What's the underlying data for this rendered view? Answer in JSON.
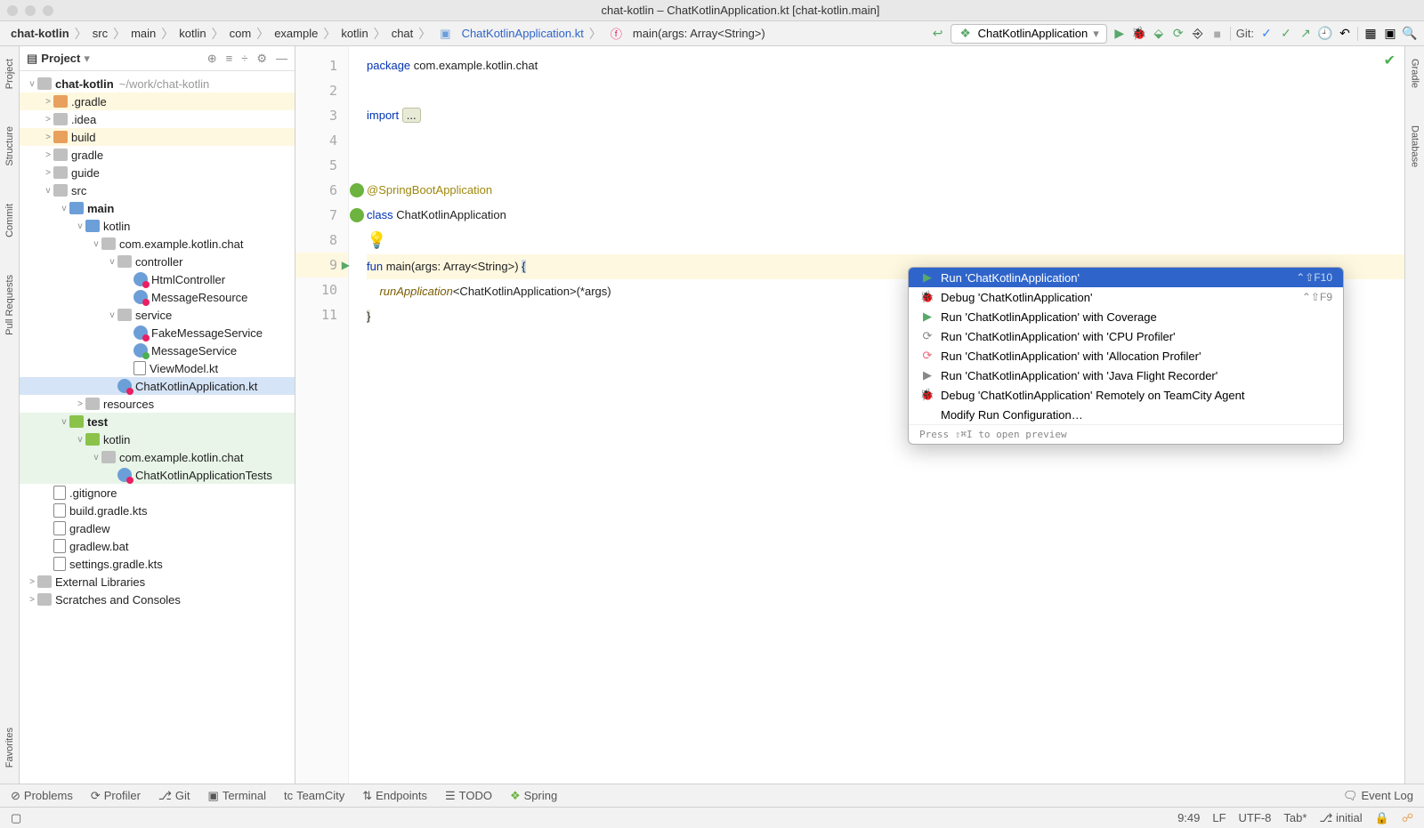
{
  "window": {
    "title": "chat-kotlin – ChatKotlinApplication.kt [chat-kotlin.main]"
  },
  "breadcrumb": {
    "parts": [
      "chat-kotlin",
      "src",
      "main",
      "kotlin",
      "com",
      "example",
      "kotlin",
      "chat"
    ],
    "file": "ChatKotlinApplication.kt",
    "method": "main(args: Array<String>)"
  },
  "runConfig": {
    "name": "ChatKotlinApplication"
  },
  "gitLabel": "Git:",
  "leftStrip": {
    "project": "Project",
    "structure": "Structure",
    "commit": "Commit",
    "pullRequests": "Pull Requests",
    "favorites": "Favorites"
  },
  "rightStrip": {
    "gradle": "Gradle",
    "database": "Database"
  },
  "projectHeader": {
    "title": "Project"
  },
  "tree": {
    "root": {
      "name": "chat-kotlin",
      "path": "~/work/chat-kotlin"
    },
    "items": [
      {
        "indent": 1,
        "tw": ">",
        "icon": "folder-orange",
        "label": ".gradle",
        "cls": "build"
      },
      {
        "indent": 1,
        "tw": ">",
        "icon": "folder-gray",
        "label": ".idea"
      },
      {
        "indent": 1,
        "tw": ">",
        "icon": "folder-orange",
        "label": "build",
        "cls": "build"
      },
      {
        "indent": 1,
        "tw": ">",
        "icon": "folder-gray",
        "label": "gradle"
      },
      {
        "indent": 1,
        "tw": ">",
        "icon": "folder-gray",
        "label": "guide"
      },
      {
        "indent": 1,
        "tw": "v",
        "icon": "folder-gray",
        "label": "src"
      },
      {
        "indent": 2,
        "tw": "v",
        "icon": "folder-blue",
        "label": "main",
        "bold": true
      },
      {
        "indent": 3,
        "tw": "v",
        "icon": "folder-blue",
        "label": "kotlin"
      },
      {
        "indent": 4,
        "tw": "v",
        "icon": "folder-gray",
        "label": "com.example.kotlin.chat"
      },
      {
        "indent": 5,
        "tw": "v",
        "icon": "folder-gray",
        "label": "controller"
      },
      {
        "indent": 6,
        "tw": "",
        "icon": "kt-pink",
        "label": "HtmlController"
      },
      {
        "indent": 6,
        "tw": "",
        "icon": "kt-pink",
        "label": "MessageResource"
      },
      {
        "indent": 5,
        "tw": "v",
        "icon": "folder-gray",
        "label": "service"
      },
      {
        "indent": 6,
        "tw": "",
        "icon": "kt-pink",
        "label": "FakeMessageService"
      },
      {
        "indent": 6,
        "tw": "",
        "icon": "kt-green",
        "label": "MessageService"
      },
      {
        "indent": 6,
        "tw": "",
        "icon": "file",
        "label": "ViewModel.kt"
      },
      {
        "indent": 5,
        "tw": "",
        "icon": "kt-pink",
        "label": "ChatKotlinApplication.kt",
        "selected": true
      },
      {
        "indent": 3,
        "tw": ">",
        "icon": "folder-gray",
        "label": "resources"
      },
      {
        "indent": 2,
        "tw": "v",
        "icon": "folder-green",
        "label": "test",
        "bold": true,
        "cls": "testgreen"
      },
      {
        "indent": 3,
        "tw": "v",
        "icon": "folder-green",
        "label": "kotlin",
        "cls": "testgreen"
      },
      {
        "indent": 4,
        "tw": "v",
        "icon": "folder-gray",
        "label": "com.example.kotlin.chat",
        "cls": "testgreen"
      },
      {
        "indent": 5,
        "tw": "",
        "icon": "kt-pink",
        "label": "ChatKotlinApplicationTests",
        "cls": "testgreen"
      },
      {
        "indent": 1,
        "tw": "",
        "icon": "file",
        "label": ".gitignore"
      },
      {
        "indent": 1,
        "tw": "",
        "icon": "file",
        "label": "build.gradle.kts"
      },
      {
        "indent": 1,
        "tw": "",
        "icon": "file",
        "label": "gradlew"
      },
      {
        "indent": 1,
        "tw": "",
        "icon": "file",
        "label": "gradlew.bat"
      },
      {
        "indent": 1,
        "tw": "",
        "icon": "file",
        "label": "settings.gradle.kts"
      }
    ],
    "extLib": "External Libraries",
    "scratches": "Scratches and Consoles"
  },
  "code": {
    "lines": [
      "1",
      "2",
      "3",
      "4",
      "5",
      "6",
      "7",
      "8",
      "9",
      "10",
      "11"
    ],
    "l1_kw": "package",
    "l1_pkg": " com.example.kotlin.chat",
    "l3_kw": "import ",
    "l3_fold": "...",
    "l6_ann": "@SpringBootApplication",
    "l7_kw": "class ",
    "l7_cls": "ChatKotlinApplication",
    "l9_kw": "fun ",
    "l9_fn": "main",
    "l9_sig": "(args: Array<String>) ",
    "l9_brace": "{",
    "l10_it": "runApplication",
    "l10_rest": "<ChatKotlinApplication>(*args)",
    "l11": "}"
  },
  "menu": {
    "items": [
      {
        "icon": "▶",
        "iconColor": "#59a869",
        "label": "Run 'ChatKotlinApplication'",
        "shortcut": "⌃⇧F10",
        "selected": true
      },
      {
        "icon": "🐞",
        "iconColor": "#59a869",
        "label": "Debug 'ChatKotlinApplication'",
        "shortcut": "⌃⇧F9"
      },
      {
        "icon": "▶",
        "iconColor": "#59a869",
        "label": "Run 'ChatKotlinApplication' with Coverage"
      },
      {
        "icon": "⟳",
        "iconColor": "#888",
        "label": "Run 'ChatKotlinApplication' with 'CPU Profiler'"
      },
      {
        "icon": "⟳",
        "iconColor": "#e67",
        "label": "Run 'ChatKotlinApplication' with 'Allocation Profiler'"
      },
      {
        "icon": "▶",
        "iconColor": "#888",
        "label": "Run 'ChatKotlinApplication' with 'Java Flight Recorder'"
      },
      {
        "icon": "🐞",
        "iconColor": "#59a869",
        "label": "Debug 'ChatKotlinApplication' Remotely on TeamCity Agent"
      },
      {
        "icon": "",
        "label": "Modify Run Configuration…"
      }
    ],
    "footer": "Press ⇧⌘I to open preview"
  },
  "bottom": {
    "problems": "Problems",
    "profiler": "Profiler",
    "git": "Git",
    "terminal": "Terminal",
    "teamcity": "TeamCity",
    "endpoints": "Endpoints",
    "todo": "TODO",
    "spring": "Spring",
    "eventLog": "Event Log"
  },
  "status": {
    "pos": "9:49",
    "le": "LF",
    "enc": "UTF-8",
    "tab": "Tab*",
    "branch": "initial"
  }
}
